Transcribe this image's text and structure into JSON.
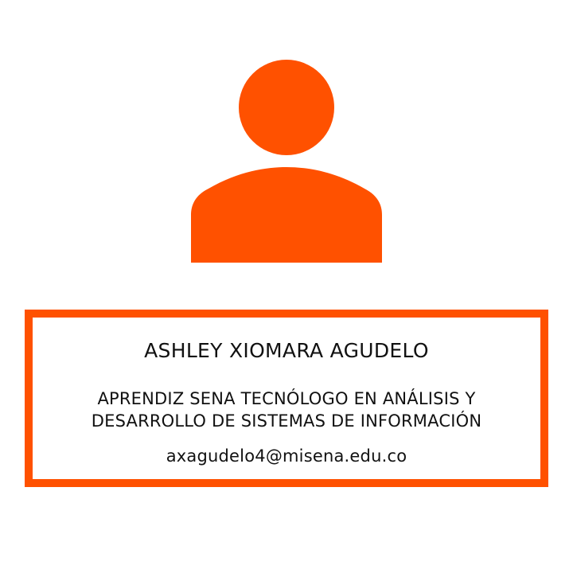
{
  "profile": {
    "avatar_icon": "user-silhouette-icon",
    "name": "ASHLEY XIOMARA AGUDELO",
    "role_line_1": "APRENDIZ SENA TECNÓLOGO EN ANÁLISIS Y",
    "role_line_2": "DESARROLLO DE SISTEMAS DE INFORMACIÓN",
    "email": "axagudelo4@misena.edu.co"
  },
  "colors": {
    "accent": "#ff5100",
    "background": "#ffffff",
    "text": "#111111"
  }
}
